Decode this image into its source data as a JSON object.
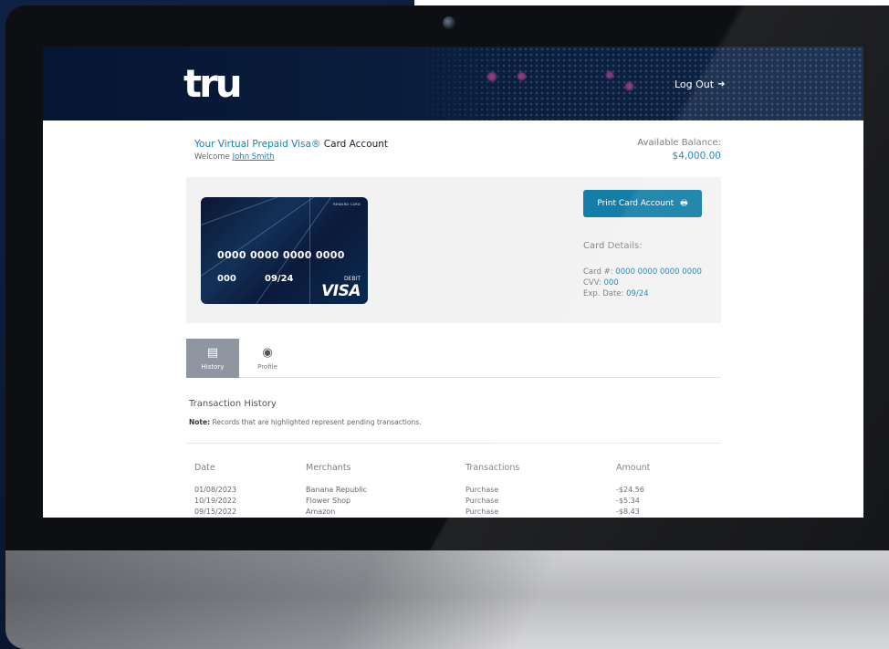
{
  "header": {
    "logo": "tru",
    "logout_label": "Log Out"
  },
  "account": {
    "title_prefix": "Your Virtual Prepaid ",
    "title_brand": "Visa®",
    "title_suffix": " Card Account",
    "welcome_label": "Welcome ",
    "user_name": "John Smith",
    "balance_label": "Available Balance:",
    "balance_value": "$4,000.00"
  },
  "card": {
    "reward_text": "REWARD CARD",
    "number": "0000 0000 0000 0000",
    "cvv": "000",
    "expiry": "09/24",
    "type": "DEBIT",
    "network": "VISA"
  },
  "actions": {
    "print_label": "Print Card Account"
  },
  "details": {
    "title": "Card Details:",
    "card_label": "Card #: ",
    "card_value": "0000 0000 0000 0000",
    "cvv_label": "CVV: ",
    "cvv_value": "000",
    "exp_label": "Exp. Date: ",
    "exp_value": "09/24"
  },
  "tabs": [
    {
      "label": "History",
      "icon": "credit-card-icon",
      "active": true
    },
    {
      "label": "Profile",
      "icon": "user-circle-icon",
      "active": false
    }
  ],
  "history": {
    "title": "Transaction History",
    "note_label": "Note:",
    "note_text": " Records that are highlighted represent pending transactions.",
    "columns": [
      "Date",
      "Merchants",
      "Transactions",
      "Amount"
    ],
    "rows": [
      [
        "01/08/2023",
        "Banana Republic",
        "Purchase",
        "-$24.56"
      ],
      [
        "10/19/2022",
        "Flower Shop",
        "Purchase",
        "-$5.34"
      ],
      [
        "09/15/2022",
        "Amazon",
        "Purchase",
        "-$8.43"
      ]
    ]
  },
  "colors": {
    "accent": "#1583b3",
    "button": "#137ea8",
    "header_bg": "#051632",
    "active_tab": "#8f96a1"
  }
}
